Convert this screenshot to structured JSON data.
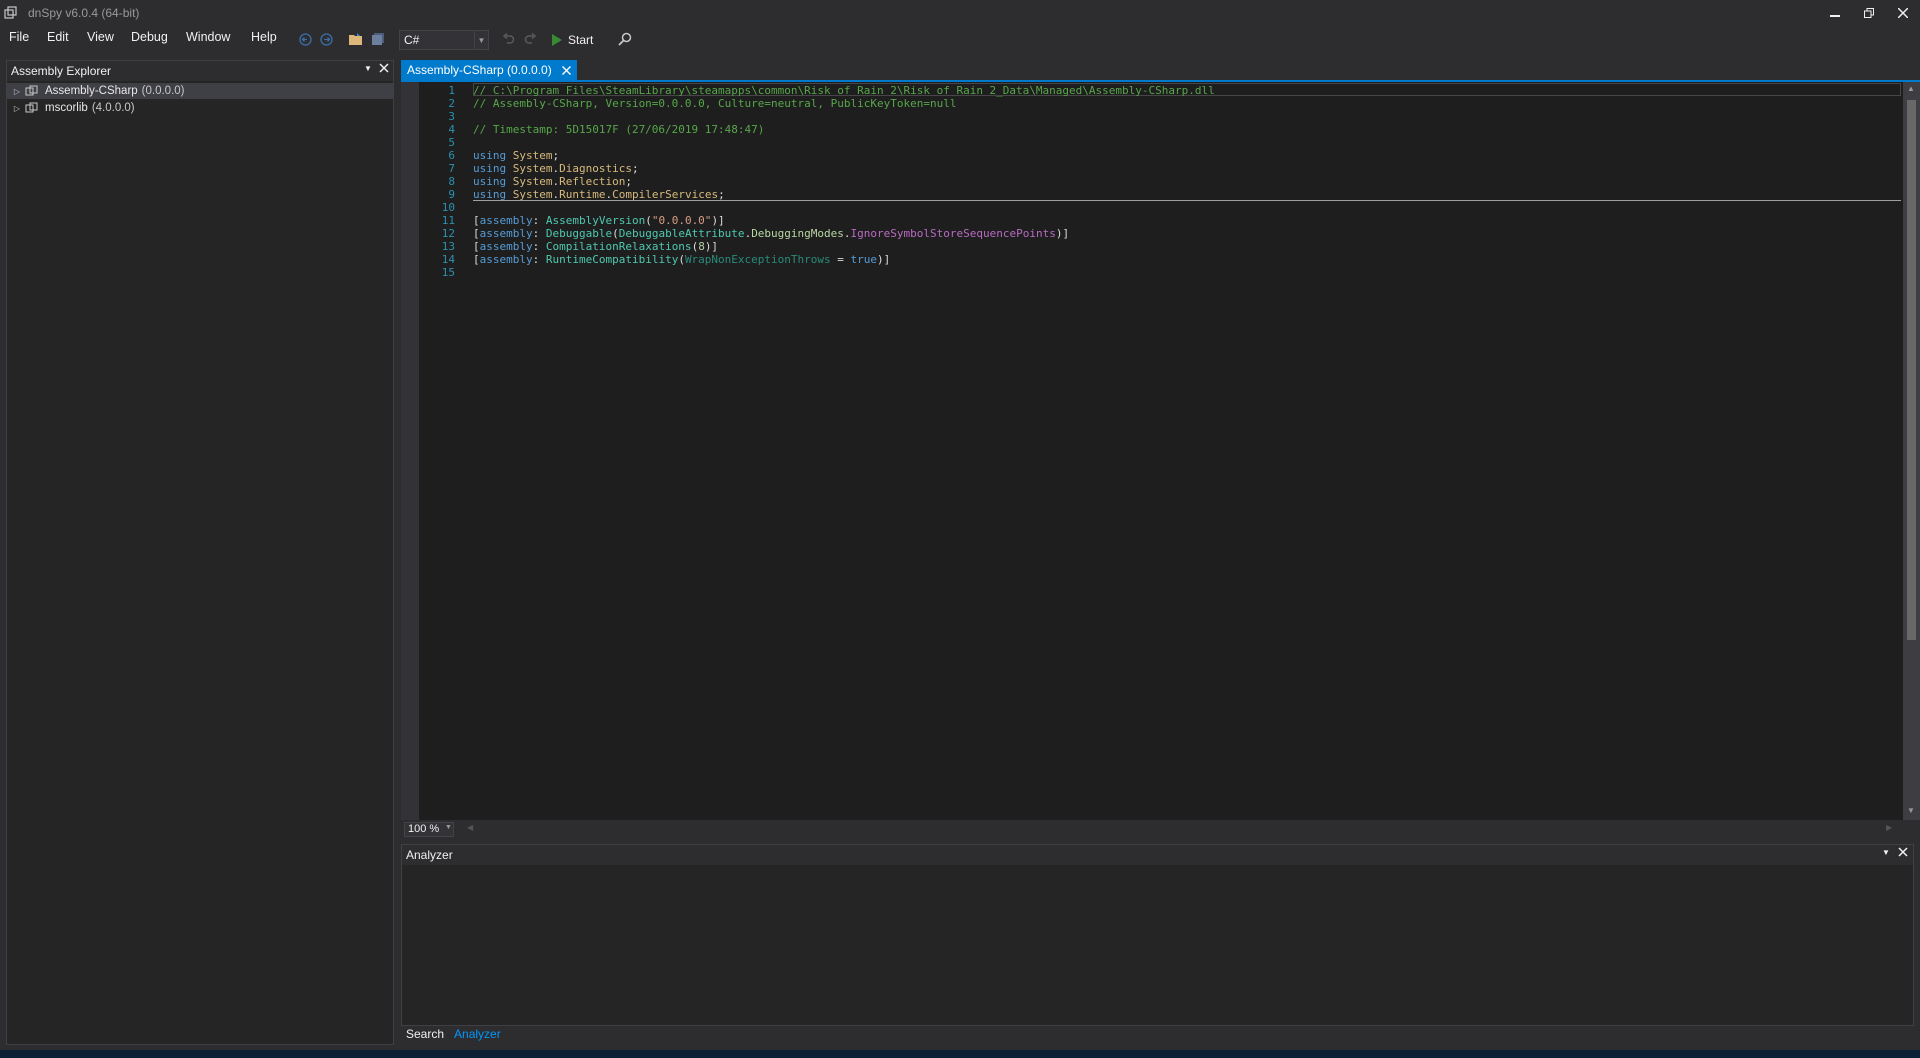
{
  "window": {
    "title": "dnSpy v6.0.4 (64-bit)",
    "minimize_icon": "minimize-icon",
    "restore_icon": "restore-icon",
    "close_icon": "close-icon"
  },
  "menu": {
    "items": [
      {
        "label": "File"
      },
      {
        "label": "Edit"
      },
      {
        "label": "View"
      },
      {
        "label": "Debug"
      },
      {
        "label": "Window"
      },
      {
        "label": "Help"
      }
    ]
  },
  "toolbar": {
    "language": "C#",
    "start_label": "Start",
    "icons": [
      "navigate-back-icon",
      "navigate-forward-icon",
      "open-file-icon",
      "save-all-icon",
      "undo-icon",
      "redo-icon",
      "start-icon",
      "search-icon"
    ]
  },
  "assembly_explorer": {
    "title": "Assembly Explorer",
    "items": [
      {
        "name": "Assembly-CSharp",
        "version": "(0.0.0.0)"
      },
      {
        "name": "mscorlib",
        "version": "(4.0.0.0)"
      }
    ]
  },
  "document_tab": {
    "label": "Assembly-CSharp (0.0.0.0)"
  },
  "code": {
    "line_numbers": [
      "1",
      "2",
      "3",
      "4",
      "5",
      "6",
      "7",
      "8",
      "9",
      "10",
      "11",
      "12",
      "13",
      "14",
      "15"
    ],
    "line1": "// C:\\Program Files\\SteamLibrary\\steamapps\\common\\Risk of Rain 2\\Risk of Rain 2_Data\\Managed\\Assembly-CSharp.dll",
    "line2": "// Assembly-CSharp, Version=0.0.0.0, Culture=neutral, PublicKeyToken=null",
    "line4": "// Timestamp: 5D15017F (27/06/2019 17:48:47)",
    "using_kw": "using",
    "ns_system": "System",
    "ns_diagnostics": "Diagnostics",
    "ns_reflection": "Reflection",
    "ns_runtime": "Runtime",
    "ns_compilerservices": "CompilerServices",
    "assembly_kw": "assembly",
    "attr_version": "AssemblyVersion",
    "version_string": "\"0.0.0.0\"",
    "attr_debuggable": "Debuggable",
    "type_debuggable_attribute": "DebuggableAttribute",
    "enum_debugging_modes": "DebuggingModes",
    "enum_value_ignore": "IgnoreSymbolStoreSequencePoints",
    "attr_compilation": "CompilationRelaxations",
    "compilation_value": "8",
    "attr_runtime_compat": "RuntimeCompatibility",
    "param_wrap": "WrapNonExceptionThrows",
    "true_kw": "true"
  },
  "zoom": "100 %",
  "analyzer": {
    "title": "Analyzer"
  },
  "bottom_tabs": [
    {
      "label": "Search"
    },
    {
      "label": "Analyzer"
    }
  ]
}
